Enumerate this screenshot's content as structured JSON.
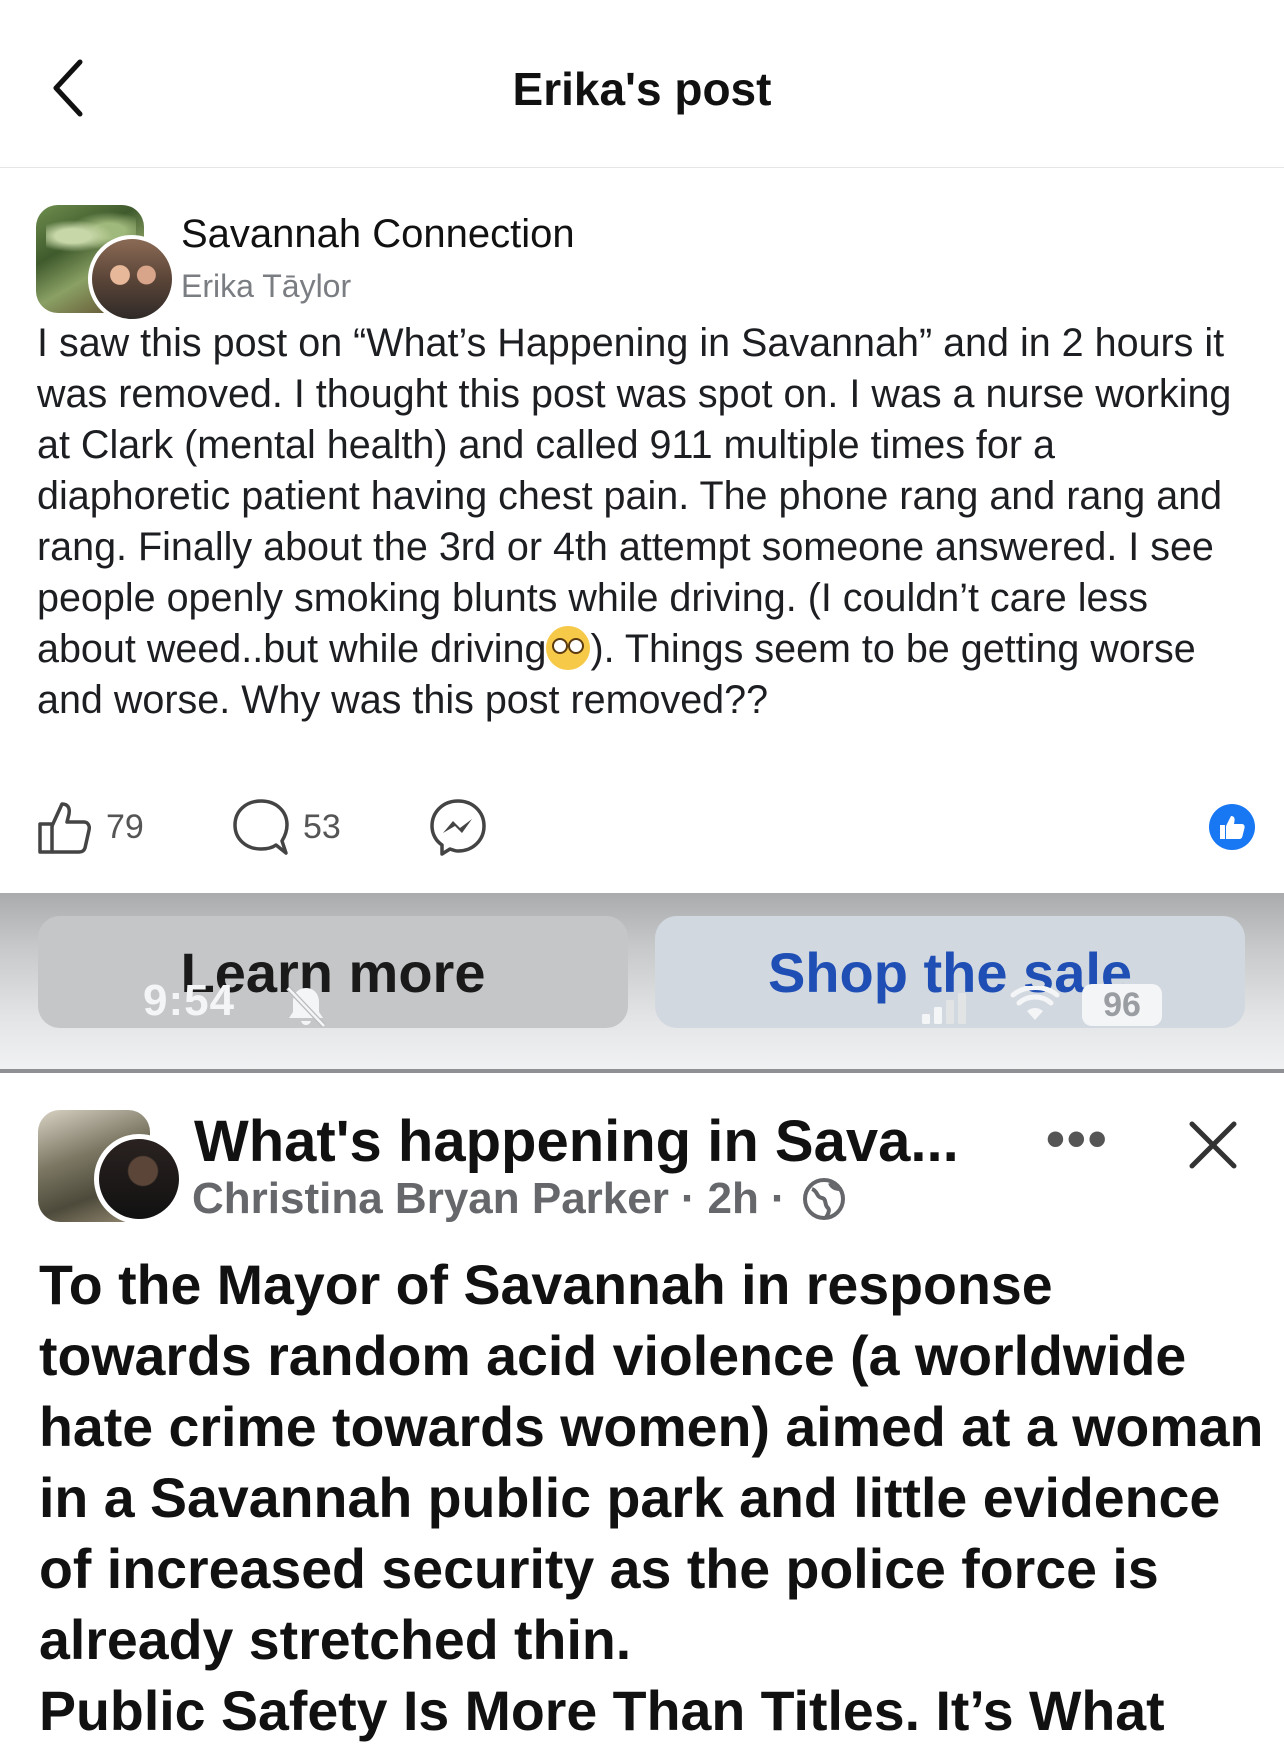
{
  "nav": {
    "title": "Erika's post"
  },
  "post": {
    "group_name": "Savannah Connection",
    "author": "Erika Tāylor",
    "text_before_emoji": "I saw this post on “What’s Happening in Savannah” and in 2 hours it was removed. I thought this post was spot on. I was a nurse working at Clark (mental health) and called 911 multiple times for a diaphoretic patient having chest pain. The phone rang and rang and rang. Finally about the 3rd or 4th attempt someone answered. I see people openly smoking blunts while driving. (I couldn’t care less about weed..but while driving",
    "text_after_emoji": "). Things seem to be getting worse and worse. Why was this post removed??",
    "emoji": "flushed-face",
    "likes": "79",
    "comments": "53",
    "reaction": "like"
  },
  "screenshot": {
    "learn_more": "Learn more",
    "shop_sale": "Shop the sale",
    "status_time": "9:54",
    "battery": "96",
    "group_name": "What's happening in Sava...",
    "more": "•••",
    "author": "Christina Bryan Parker",
    "dot1": "·",
    "time": "2h",
    "dot2": "·",
    "body": "To the Mayor of Savannah in response towards random acid violence (a worldwide hate crime towards women) aimed at a woman in a Savannah public park and little evidence of increased security as the police force is already stretched thin.",
    "body_cut": "Public Safety Is More Than Titles. It’s What"
  },
  "colors": {
    "text": "#1c1e21",
    "muted": "#7a7d82",
    "link_blue": "#1f4fb5",
    "like_blue": "#1877f2"
  }
}
